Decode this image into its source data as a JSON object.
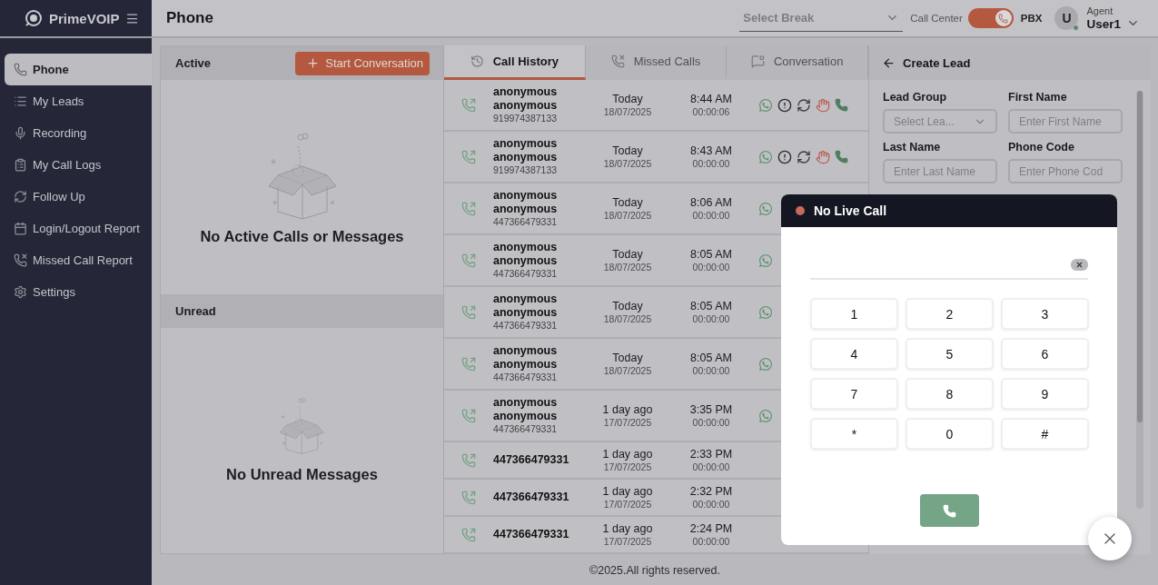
{
  "brand": {
    "name": "PrimeVOIP"
  },
  "sidebar": {
    "items": [
      {
        "label": "Phone",
        "selected": true
      },
      {
        "label": "My Leads",
        "selected": false
      },
      {
        "label": "Recording",
        "selected": false
      },
      {
        "label": "My Call Logs",
        "selected": false
      },
      {
        "label": "Follow Up",
        "selected": false
      },
      {
        "label": "Login/Logout Report",
        "selected": false
      },
      {
        "label": "Missed Call Report",
        "selected": false
      },
      {
        "label": "Settings",
        "selected": false
      }
    ]
  },
  "header": {
    "title": "Phone",
    "break_select": {
      "placeholder": "Select Break"
    },
    "mode_left": "Call Center",
    "mode_toggle": {
      "on": true
    },
    "mode_right": "PBX",
    "user": {
      "initial": "U",
      "online": true,
      "role": "Agent",
      "name": "User1"
    }
  },
  "active_panel": {
    "title": "Active",
    "button": "Start Conversation",
    "empty": "No Active Calls or Messages"
  },
  "unread_panel": {
    "title": "Unread",
    "empty": "No Unread Messages"
  },
  "tabs": [
    {
      "label": "Call History",
      "selected": true
    },
    {
      "label": "Missed Calls",
      "selected": false
    },
    {
      "label": "Conversation",
      "selected": false
    }
  ],
  "calls": [
    {
      "name": "anonymous anonymous",
      "number": "919974387133",
      "day": "Today",
      "date": "18/07/2025",
      "time": "8:44 AM",
      "duration": "00:00:06"
    },
    {
      "name": "anonymous anonymous",
      "number": "919974387133",
      "day": "Today",
      "date": "18/07/2025",
      "time": "8:43 AM",
      "duration": "00:00:00"
    },
    {
      "name": "anonymous anonymous",
      "number": "447366479331",
      "day": "Today",
      "date": "18/07/2025",
      "time": "8:06 AM",
      "duration": "00:00:00"
    },
    {
      "name": "anonymous anonymous",
      "number": "447366479331",
      "day": "Today",
      "date": "18/07/2025",
      "time": "8:05 AM",
      "duration": "00:00:00"
    },
    {
      "name": "anonymous anonymous",
      "number": "447366479331",
      "day": "Today",
      "date": "18/07/2025",
      "time": "8:05 AM",
      "duration": "00:00:00"
    },
    {
      "name": "anonymous anonymous",
      "number": "447366479331",
      "day": "Today",
      "date": "18/07/2025",
      "time": "8:05 AM",
      "duration": "00:00:00"
    },
    {
      "name": "anonymous anonymous",
      "number": "447366479331",
      "day": "1 day ago",
      "date": "17/07/2025",
      "time": "3:35 PM",
      "duration": "00:00:00"
    },
    {
      "name": "447366479331",
      "day": "1 day ago",
      "date": "17/07/2025",
      "time": "2:33 PM",
      "duration": "00:00:00"
    },
    {
      "name": "447366479331",
      "day": "1 day ago",
      "date": "17/07/2025",
      "time": "2:32 PM",
      "duration": "00:00:00"
    },
    {
      "name": "447366479331",
      "day": "1 day ago",
      "date": "17/07/2025",
      "time": "2:24 PM",
      "duration": "00:00:00"
    }
  ],
  "lead_form": {
    "title": "Create Lead",
    "fields": [
      {
        "label": "Lead Group",
        "kind": "select",
        "placeholder": "Select Lea..."
      },
      {
        "label": "First Name",
        "kind": "text",
        "placeholder": "Enter First Name"
      },
      {
        "label": "Last Name",
        "kind": "text",
        "placeholder": "Enter Last Name"
      },
      {
        "label": "Phone Code",
        "kind": "text",
        "placeholder": "Enter Phone Cod"
      }
    ]
  },
  "dialer": {
    "title": "No Live Call",
    "live": false,
    "keys": [
      "1",
      "2",
      "3",
      "4",
      "5",
      "6",
      "7",
      "8",
      "9",
      "*",
      "0",
      "#"
    ]
  },
  "footer": "©2025.All rights reserved."
}
